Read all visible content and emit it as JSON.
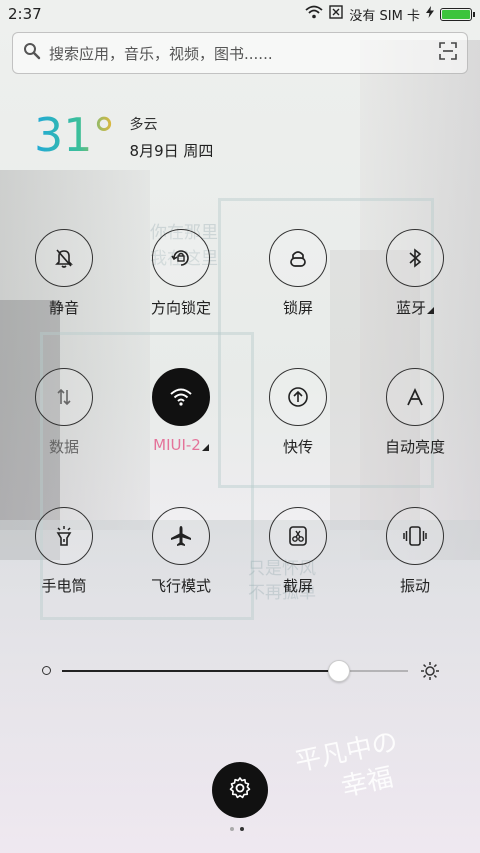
{
  "status_bar": {
    "time": "2:37",
    "carrier": "没有 SIM 卡",
    "battery_level": 1.0
  },
  "search": {
    "placeholder": "搜索应用，音乐，视频，图书......"
  },
  "weather": {
    "temperature": "31",
    "degree_symbol": "°",
    "condition": "多云",
    "date": "8月9日 周四"
  },
  "toggles": [
    {
      "label": "静音",
      "icon": "mute-bell-icon",
      "active": false
    },
    {
      "label": "方向锁定",
      "icon": "rotation-lock-icon",
      "active": false
    },
    {
      "label": "锁屏",
      "icon": "lock-icon",
      "active": false
    },
    {
      "label": "蓝牙",
      "icon": "bluetooth-icon",
      "active": false
    },
    {
      "label": "数据",
      "icon": "mobile-data-icon",
      "active": false
    },
    {
      "label": "MIUI-2",
      "icon": "wifi-icon",
      "active": true
    },
    {
      "label": "快传",
      "icon": "quick-transfer-icon",
      "active": false
    },
    {
      "label": "自动亮度",
      "icon": "auto-brightness-icon",
      "active": false
    },
    {
      "label": "手电筒",
      "icon": "flashlight-icon",
      "active": false
    },
    {
      "label": "飞行模式",
      "icon": "airplane-icon",
      "active": false
    },
    {
      "label": "截屏",
      "icon": "screenshot-icon",
      "active": false
    },
    {
      "label": "振动",
      "icon": "vibrate-icon",
      "active": false
    }
  ],
  "brightness": {
    "level": 0.8
  },
  "pager": {
    "pages": 2,
    "current": 2
  },
  "wallpaper": {
    "caption_line1": "平凡中の",
    "caption_line2": "幸福",
    "sign_text_top": "你在那里",
    "sign_text_top2": "我在这里",
    "sign_text_bottom": "只是怀风",
    "sign_text_bottom2": "不再孤单"
  },
  "colors": {
    "accent_pink": "#e4739a",
    "battery_green": "#3cc43c",
    "temp_gradient": [
      "#21a9d8",
      "#3bbf9a",
      "#f3b632"
    ]
  }
}
